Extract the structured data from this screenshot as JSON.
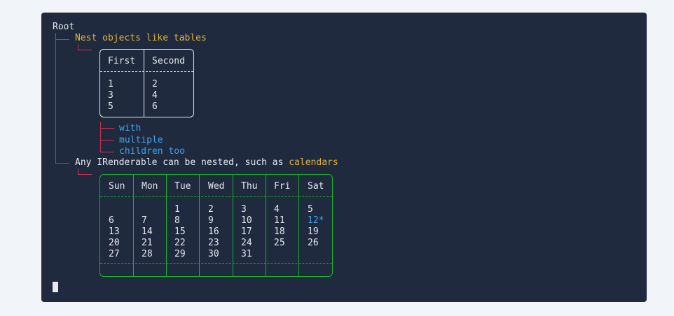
{
  "tree": {
    "root_label": "Root",
    "node1_label": "Nest objects like tables",
    "table": {
      "headers": [
        "First",
        "Second"
      ],
      "columns": [
        [
          "1",
          "3",
          "5"
        ],
        [
          "2",
          "4",
          "6"
        ]
      ]
    },
    "children": [
      "with",
      "multiple",
      "children too"
    ],
    "node2_prefix": "Any IRenderable can be nested, such as",
    "node2_highlight": "calendars",
    "calendar": {
      "headers": [
        "Sun",
        "Mon",
        "Tue",
        "Wed",
        "Thu",
        "Fri",
        "Sat"
      ],
      "columns": [
        [
          "",
          "6",
          "13",
          "20",
          "27"
        ],
        [
          "",
          "7",
          "14",
          "21",
          "28"
        ],
        [
          "1",
          "8",
          "15",
          "22",
          "29"
        ],
        [
          "2",
          "9",
          "16",
          "23",
          "30"
        ],
        [
          "3",
          "10",
          "17",
          "24",
          "31"
        ],
        [
          "4",
          "11",
          "18",
          "25",
          ""
        ],
        [
          "5",
          "12*",
          "19",
          "26",
          ""
        ]
      ],
      "highlighted_day": "12*"
    }
  },
  "colors": {
    "background": "#1f2a3e",
    "text": "#e6e9ee",
    "node_yellow": "#e0b33e",
    "child_blue": "#3fa3ee",
    "guide_red": "#c8344f",
    "calendar_border": "#18b030",
    "table_border": "#e6e9ee"
  }
}
